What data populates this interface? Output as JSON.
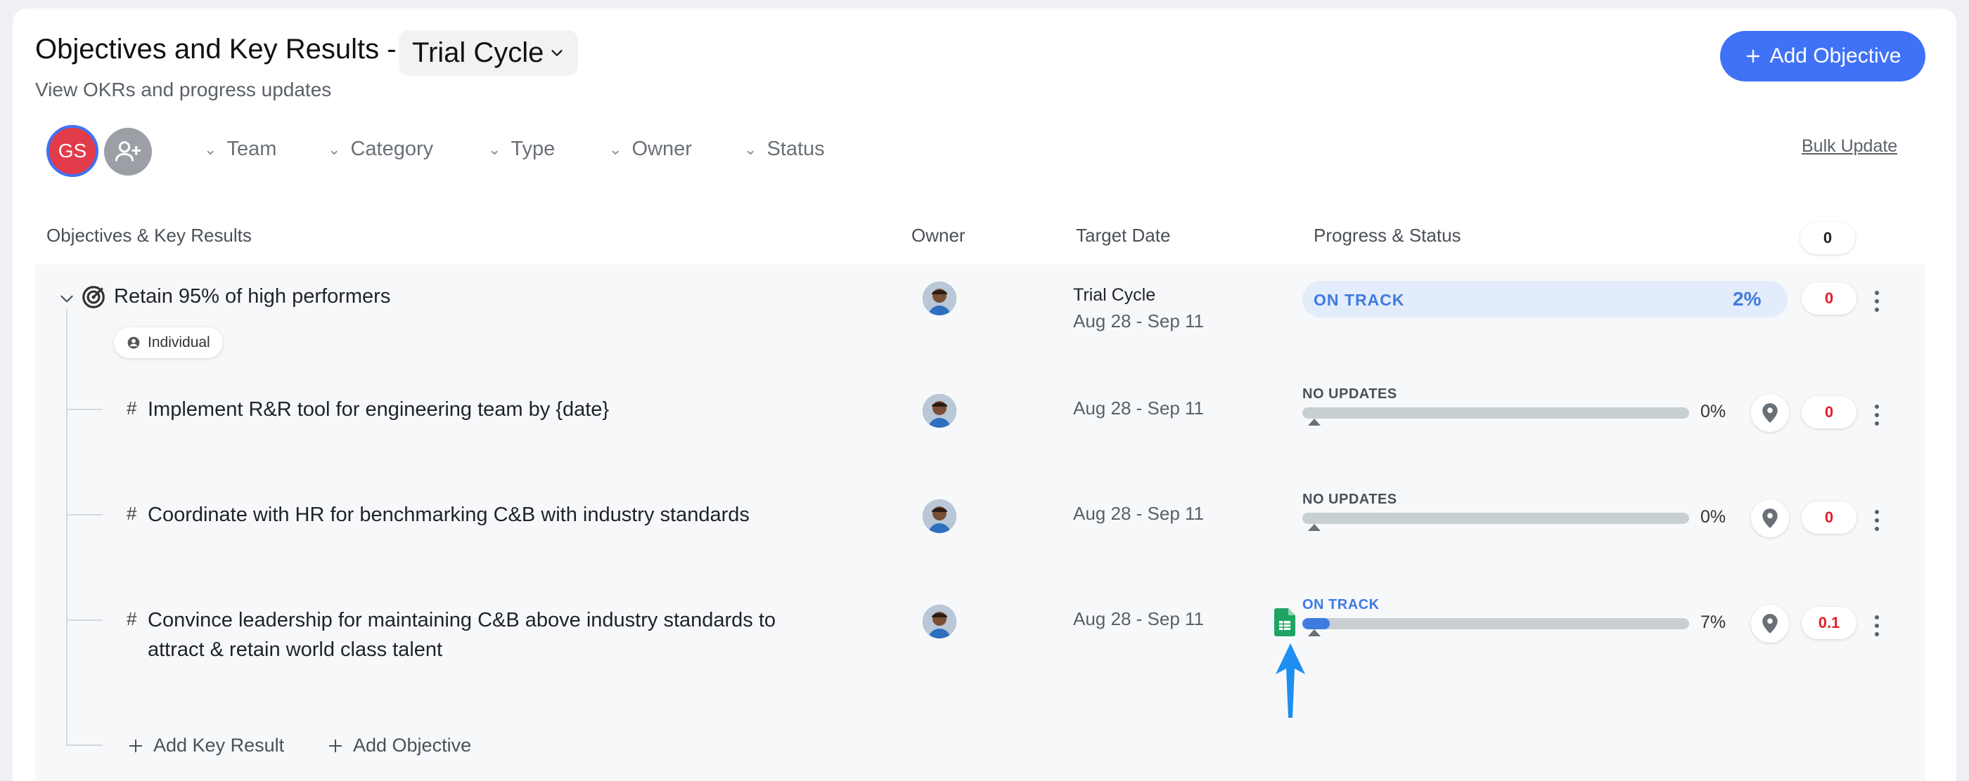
{
  "header": {
    "title": "Objectives and Key Results -",
    "cycle": "Trial Cycle",
    "subtitle": "View OKRs and progress updates",
    "add_objective": "Add Objective"
  },
  "filters": {
    "avatar_initials": "GS",
    "items": [
      "Team",
      "Category",
      "Type",
      "Owner",
      "Status"
    ],
    "bulk_update": "Bulk Update"
  },
  "table": {
    "headers": {
      "objectives": "Objectives & Key Results",
      "owner": "Owner",
      "target_date": "Target Date",
      "progress": "Progress & Status",
      "count": "0"
    },
    "objective": {
      "title": "Retain 95% of high performers",
      "tag": "Individual",
      "cycle": "Trial Cycle",
      "dates": "Aug 28 - Sep 11",
      "status": "ON TRACK",
      "progress_pct": "2%",
      "progress": 0.02,
      "comments": "0"
    },
    "key_results": [
      {
        "title": "Implement R&R tool for engineering team by {date}",
        "dates": "Aug 28 - Sep 11",
        "status": "NO UPDATES",
        "status_color": "#4a5058",
        "progress_pct": "0%",
        "progress": 0,
        "comments": "0"
      },
      {
        "title": "Coordinate with HR for benchmarking C&B with industry standards",
        "dates": "Aug 28 - Sep 11",
        "status": "NO UPDATES",
        "status_color": "#4a5058",
        "progress_pct": "0%",
        "progress": 0,
        "comments": "0"
      },
      {
        "title": "Convince leadership for maintaining C&B above industry standards to attract & retain world class talent",
        "dates": "Aug 28 - Sep 11",
        "status": "ON TRACK",
        "status_color": "#3e7be0",
        "progress_pct": "7%",
        "progress": 0.07,
        "comments": "0.1"
      }
    ],
    "add_key_result": "Add Key Result",
    "add_objective": "Add Objective"
  },
  "colors": {
    "accent": "#3f72f6",
    "on_track": "#3e7be0",
    "alert": "#e0202a"
  }
}
